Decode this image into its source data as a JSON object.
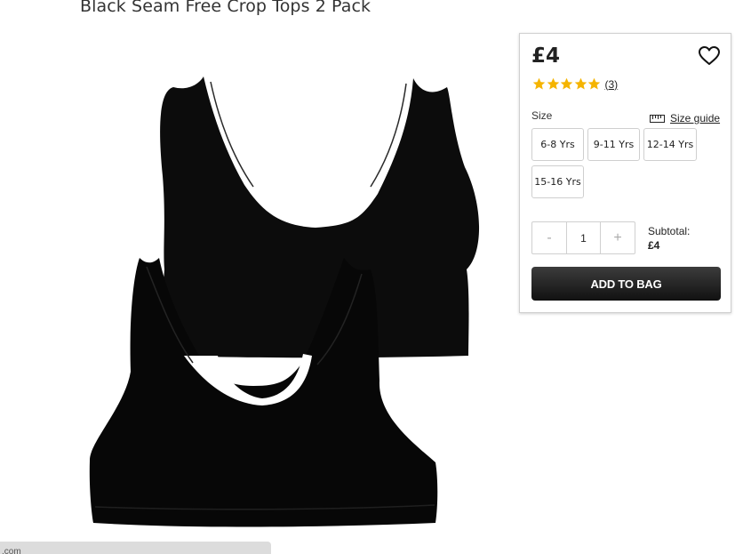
{
  "product": {
    "title": "Black Seam Free Crop Tops 2 Pack",
    "image_name": "black-crop-tops-product-image"
  },
  "status_bar": {
    "text": ".com"
  },
  "buy_panel": {
    "price": "£4",
    "rating": {
      "stars": 5,
      "count_label": "(3)",
      "star_color": "#f5b400"
    },
    "size_label": "Size",
    "size_guide_label": "Size guide",
    "sizes": [
      "6-8 Yrs",
      "9-11 Yrs",
      "12-14 Yrs",
      "15-16 Yrs"
    ],
    "quantity": {
      "minus": "-",
      "value": "1",
      "plus": "+"
    },
    "subtotal_label": "Subtotal:",
    "subtotal_value": "£4",
    "add_to_bag_label": "ADD TO BAG",
    "button_color": "#222222"
  }
}
